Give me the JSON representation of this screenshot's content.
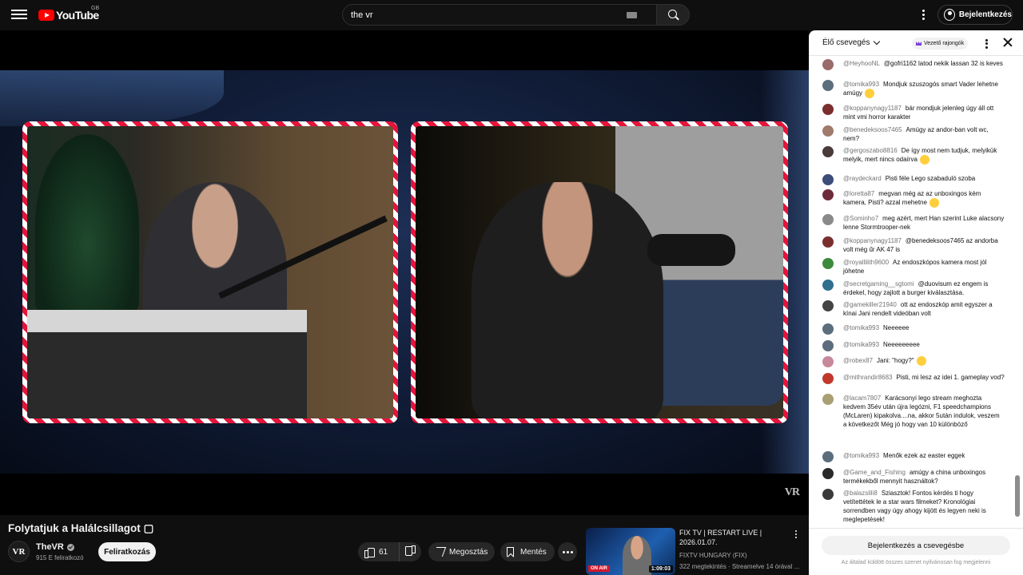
{
  "header": {
    "logo_text": "YouTube",
    "region": "GB",
    "search_value": "the vr",
    "signin_label": "Bejelentkezés"
  },
  "video": {
    "watermark": "VR",
    "title": "Folytatjuk a Halálcsillagot",
    "title_suffix": "▢"
  },
  "channel": {
    "avatar_text": "VR",
    "name": "TheVR",
    "subscribers": "915 E feliratkozó",
    "subscribe_label": "Feliratkozás"
  },
  "actions": {
    "likes": "61",
    "share_label": "Megosztás",
    "save_label": "Mentés"
  },
  "recommended": {
    "title": "FIX TV | RESTART LIVE | 2026.01.07.",
    "channel": "FIXTV HUNGARY (FIX)",
    "views": "322 megtekintés · Streamelve 14 órával ...",
    "duration": "1:09:03",
    "badge": "ON AIR"
  },
  "chat": {
    "title": "Élő csevegés",
    "fans_label": "Vezető rajongók",
    "login_label": "Bejelentkezés a csevegésbe",
    "note": "Az általad küldött összes üzenet nyilvánosan fog megjelenni",
    "messages": [
      {
        "author": "@HeyhooNL",
        "text": "@gofri1162 latod nekik lassan 32 is keves",
        "color": "#9a6b6b"
      },
      {
        "author": "@tomika993",
        "text": "Mondjuk szuszogós smart Vader lehetne amúgy",
        "color": "#5c6d7d"
      },
      {
        "author": "@koppanynagy1187",
        "text": "bár mondjuk jelenleg úgy áll ott mint vmi horror karakter",
        "color": "#7a2e2e"
      },
      {
        "author": "@benedeksoos7465",
        "text": "Amúgy az andor-ban volt wc, nem?",
        "color": "#a07a6a"
      },
      {
        "author": "@gergoszabo8816",
        "text": "De így most nem tudjuk, melyikük melyik, mert nincs odaírva",
        "color": "#4a3a3a"
      },
      {
        "author": "@raydeckard",
        "text": "Pisti féle Lego szabaduló szoba",
        "color": "#3e4c7a"
      },
      {
        "author": "@loretta87",
        "text": "megvan még az az unboxingos kém kamera, Pisti? azzal mehetne",
        "color": "#6d2a3a"
      },
      {
        "author": "@Sominho7",
        "text": "meg azért, mert Han szerint Luke alacsony lenne Stormtrooper-nek",
        "color": "#8a8a8a"
      },
      {
        "author": "@koppanynagy1187",
        "text": "@benedeksoos7465 az andorba volt még űr AK 47 is",
        "color": "#7a2e2e"
      },
      {
        "author": "@royallilith9600",
        "text": "Az endoszkópos kamera most jól jöhetne",
        "color": "#3d8a3d"
      },
      {
        "author": "@secretgaming__sgtomi",
        "text": "@duovisum ez engem is érdekel, hogy zajlott a burger kiválasztása.",
        "color": "#2f6f8f"
      },
      {
        "author": "@gamekiller21940",
        "text": "ott az endoszkóp amit egyszer a kínai Jani rendelt videóban volt",
        "color": "#444"
      },
      {
        "author": "@tomika993",
        "text": "Neeeeee",
        "color": "#5c6d7d"
      },
      {
        "author": "@tomika993",
        "text": "Neeeeeeeee",
        "color": "#5c6d7d"
      },
      {
        "author": "@robex87",
        "text": "Jani: \"hogy?\"",
        "color": "#c7889a"
      },
      {
        "author": "@mithrandir8683",
        "text": "Pisti, mi lesz az idei 1. gameplay vod?",
        "color": "#c0392b"
      },
      {
        "author": "@lacam7807",
        "text": "Karácsonyi lego stream meghozta kedvem 35év után újra legózni, F1 speedchampions (McLaren) kipakolva....na, akkor 5után indulok, veszem a következőt  Még jó hogy van 10 különböző",
        "color": "#a89f73"
      },
      {
        "author": "@tomika993",
        "text": "Menők ezek az easter eggek",
        "color": "#5c6d7d"
      },
      {
        "author": "@Game_and_Fishing",
        "text": "amúgy a china unboxingos termékekből mennyit használtok?",
        "color": "#2a2a2a"
      },
      {
        "author": "@balazslili8",
        "text": "Sziasztok! Fontos kérdés ti hogy vetítettétek le a star wars filmeket? Kronológiai sorrendben vagy úgy ahogy kijött és legyen neki is meglepetések!",
        "color": "#3a3a3a"
      }
    ]
  }
}
